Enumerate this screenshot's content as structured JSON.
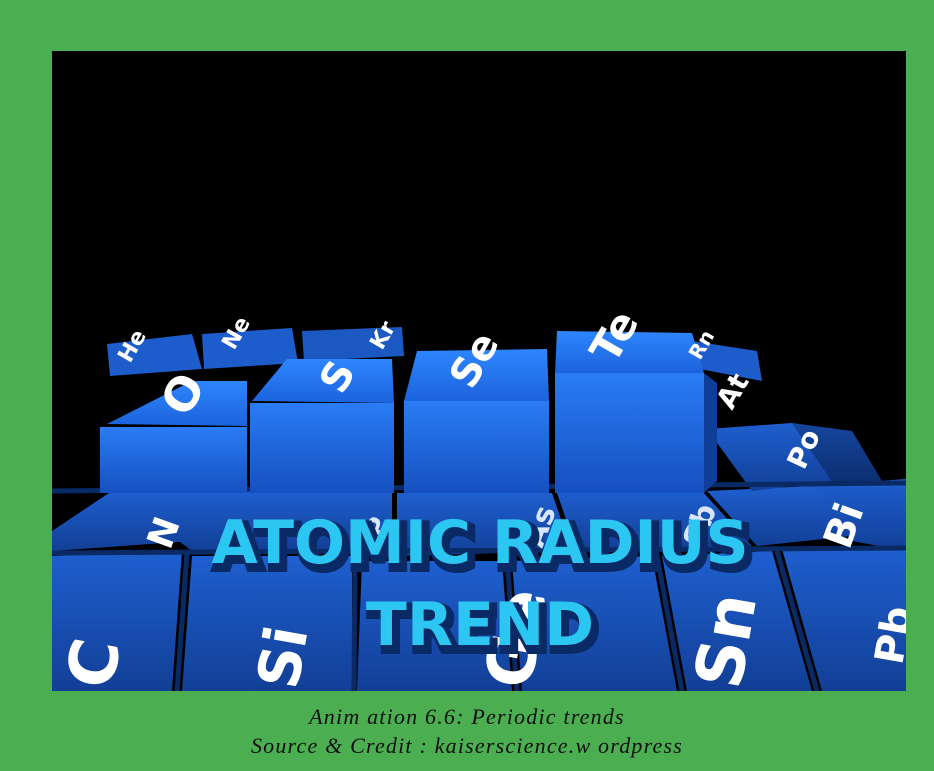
{
  "animation": {
    "title_line1": "ATOMIC RADIUS",
    "title_line2": "TREND",
    "tile_symbols": {
      "He": "He",
      "O": "O",
      "Ne": "Ne",
      "S": "S",
      "Kr": "Kr",
      "Se": "Se",
      "Te": "Te",
      "Rn": "Rn",
      "At": "At",
      "Po": "Po",
      "N": "N",
      "Bi": "Bi",
      "C": "C",
      "Si": "Si",
      "Ge": "Ge",
      "Sn": "Sn",
      "P": "P",
      "As": "As",
      "Sb": "Sb",
      "Pb": "Pb"
    }
  },
  "caption": {
    "line1": "Anim ation 6.6: Periodic trends",
    "line2": "Source & Credit : kaiserscience.w ordpress"
  },
  "colors": {
    "frame": "#4bae50",
    "background": "#000000",
    "tile_top": "#1f6fe8",
    "tile_side": "#0d3f9e",
    "tile_base": "#1a55c4",
    "title_cyan": "#29c3f0"
  }
}
